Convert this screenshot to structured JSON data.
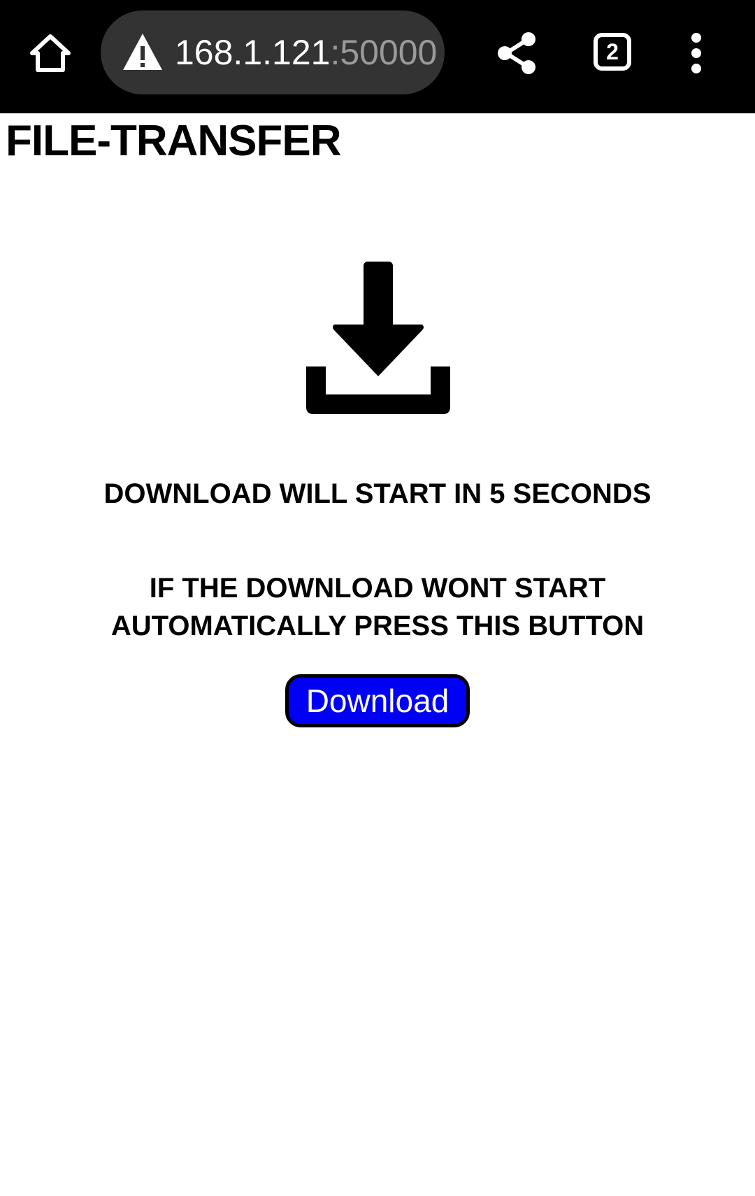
{
  "browser": {
    "url_host": "168.1.121",
    "url_port": ":50000",
    "tab_count": "2",
    "home_icon": "home-icon",
    "security_icon": "warning-icon",
    "share_icon": "share-icon",
    "menu_icon": "more-vertical-icon"
  },
  "page": {
    "title": "FILE-TRANSFER",
    "icon": "download-icon",
    "countdown_message": "DOWNLOAD WILL START IN 5 SECONDS",
    "fallback_line1": "IF THE DOWNLOAD WONT START",
    "fallback_line2": "AUTOMATICALLY PRESS THIS BUTTON",
    "download_button_label": "Download"
  },
  "colors": {
    "browser_bar": "#000000",
    "url_pill": "#333333",
    "button_fill": "#0000f5",
    "button_border": "#000000"
  }
}
